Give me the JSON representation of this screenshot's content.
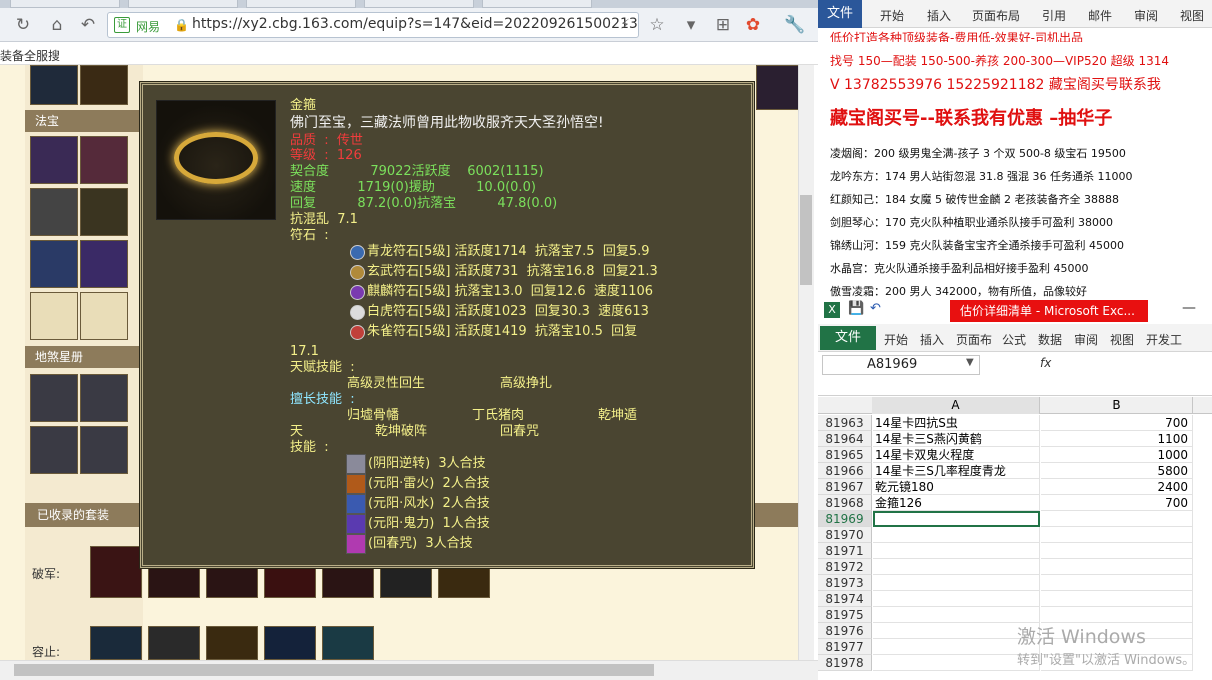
{
  "browser": {
    "site_label": "网易",
    "url": "https://xy2.cbg.163.com/equip?s=147&eid=202209261500213",
    "bookmark_text": "装备全服搜"
  },
  "game": {
    "section_fabao": "法宝",
    "section_dishaxingce": "地煞星册",
    "section_suits": "已收录的套装",
    "row_pojun": "破军:",
    "row_rongzhi": "容止:"
  },
  "tooltip": {
    "name": "金箍",
    "desc": "佛门至宝，三藏法师曾用此物收服齐天大圣孙悟空!",
    "red_line1": "品质  :  传世",
    "red_line2": "等级  :  126",
    "stat_line1": "契合度          79022活跃度    6002(1115)",
    "stat_line2": "速度          1719(0)援助          10.0(0.0)",
    "stat_line3": "回复          87.2(0.0)抗落宝          47.8(0.0)",
    "stat_line4": "抗混乱  7.1",
    "fushi_label": "符石  :",
    "runes": [
      "青龙符石[5级] 活跃度1714  抗落宝7.5  回复5.9",
      "玄武符石[5级] 活跃度731  抗落宝16.8  回复21.3",
      "麒麟符石[5级] 抗落宝13.0  回复12.6  速度1106",
      "白虎符石[5级] 活跃度1023  回复30.3  速度613",
      "朱雀符石[5级] 活跃度1419  抗落宝10.5  回复"
    ],
    "rune_tail": "17.1",
    "talent_label": "天赋技能  :",
    "talent1": "高级灵性回生",
    "talent2": "高级挣扎",
    "expert_label": "擅长技能  :",
    "expert1": "归墟骨幡",
    "expert2": "丁氏猪肉",
    "expert3": "乾坤遁",
    "expert4": "天",
    "expert5": "乾坤破阵",
    "expert6": "回春咒",
    "skill_label": "技能  :",
    "skills": [
      "(阴阳逆转)  3人合技",
      "(元阳·雷火)  2人合技",
      "(元阳·风水)  2人合技",
      "(元阳·鬼力)  1人合技",
      "(回春咒)  3人合技"
    ]
  },
  "word": {
    "tabs": [
      "文件",
      "开始",
      "插入",
      "页面布局",
      "引用",
      "邮件",
      "审阅",
      "视图"
    ],
    "lines": [
      "低价打造各种顶级装备-费用低-效果好-司机出品",
      "找号 150—配装 150-500-养孩 200-300—VIP520 超级 1314",
      "V 13782553976   15225921182  藏宝阁买号联系我",
      "藏宝阁买号--联系我有优惠 –抽华子",
      "凌烟阁：200 级男鬼全满-孩子 3 个双 500-8 级宝石 19500",
      "龙吟东方：174 男人站街忽混 31.8 强混 36 任务通杀 11000",
      "红颜知己：184 女魔 5 破传世金麟 2 老孩装备齐全 38888",
      "剑胆琴心：170 克火队种植职业通杀队接手可盈利 38000",
      "锦绣山河：159 克火队装备宝宝齐全通杀接手可盈利 45000",
      "水晶宫：克火队通杀接手盈利品相好接手盈利 45000",
      "傲雪凌霜：200 男人 342000，物有所值，品像较好"
    ]
  },
  "excel": {
    "title": "估价详细清单 - Microsoft Exc...",
    "tabs": [
      "文件",
      "开始",
      "插入",
      "页面布",
      "公式",
      "数据",
      "审阅",
      "视图",
      "开发工"
    ],
    "name_box": "A81969",
    "fx": "fx",
    "col_a": "A",
    "col_b": "B",
    "rows": [
      {
        "n": "81963",
        "a": "14星卡四抗S虫",
        "b": "700"
      },
      {
        "n": "81964",
        "a": "14星卡三S燕闪黄鹤",
        "b": "1100"
      },
      {
        "n": "81965",
        "a": "14星卡双鬼火程度",
        "b": "1000"
      },
      {
        "n": "81966",
        "a": "14星卡三S几率程度青龙",
        "b": "5800"
      },
      {
        "n": "81967",
        "a": "乾元镜180",
        "b": "2400"
      },
      {
        "n": "81968",
        "a": "金箍126",
        "b": "700"
      },
      {
        "n": "81969",
        "a": "",
        "b": ""
      },
      {
        "n": "81970",
        "a": "",
        "b": ""
      },
      {
        "n": "81971",
        "a": "",
        "b": ""
      },
      {
        "n": "81972",
        "a": "",
        "b": ""
      },
      {
        "n": "81973",
        "a": "",
        "b": ""
      },
      {
        "n": "81974",
        "a": "",
        "b": ""
      },
      {
        "n": "81975",
        "a": "",
        "b": ""
      },
      {
        "n": "81976",
        "a": "",
        "b": ""
      },
      {
        "n": "81977",
        "a": "",
        "b": ""
      },
      {
        "n": "81978",
        "a": "",
        "b": ""
      }
    ]
  },
  "watermark": {
    "line1": "激活 Windows",
    "line2": "转到\"设置\"以激活 Windows。"
  }
}
